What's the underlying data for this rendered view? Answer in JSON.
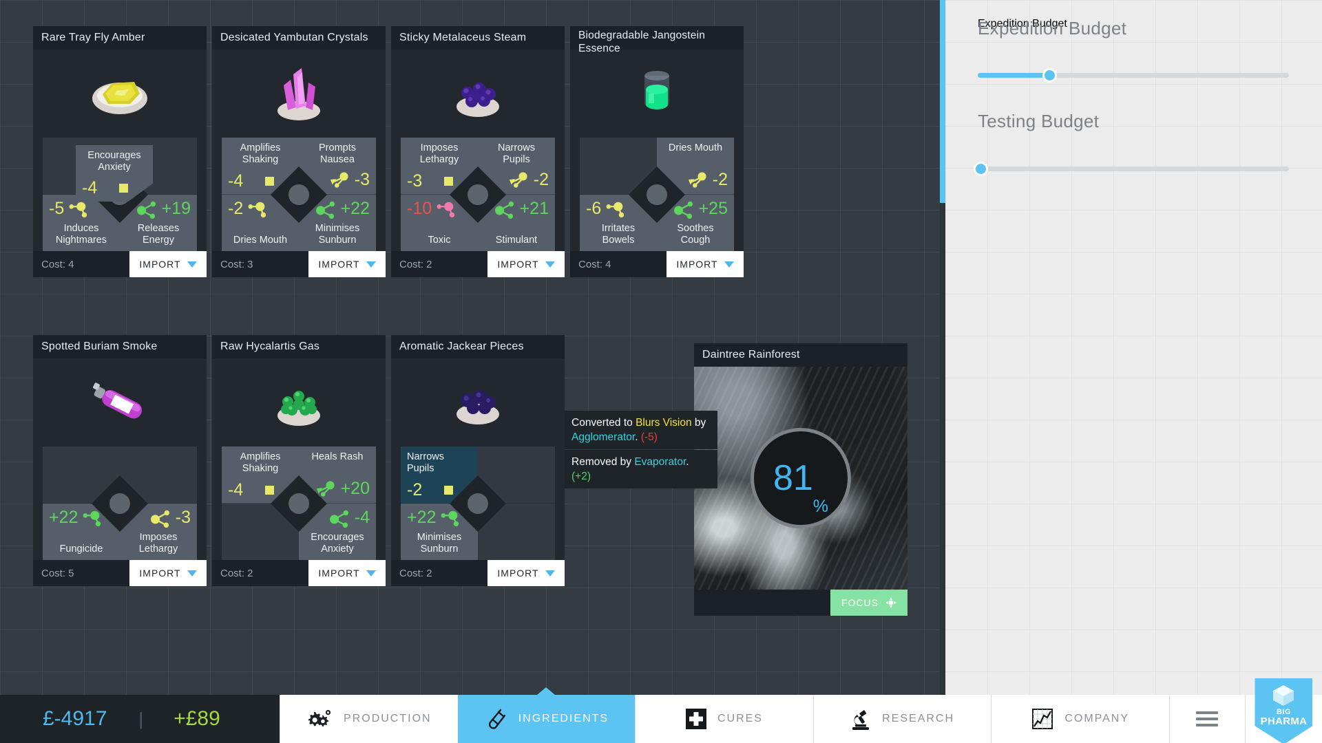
{
  "money": {
    "cash": "£-4917",
    "separator": "|",
    "income": "+£89"
  },
  "nav": {
    "tabs": [
      {
        "label": "PRODUCTION",
        "icon": "gears-icon",
        "active": false
      },
      {
        "label": "INGREDIENTS",
        "icon": "test-tube-icon",
        "active": true
      },
      {
        "label": "CURES",
        "icon": "medical-cross-icon",
        "active": false
      },
      {
        "label": "RESEARCH",
        "icon": "microscope-icon",
        "active": false
      },
      {
        "label": "COMPANY",
        "icon": "line-chart-icon",
        "active": false
      }
    ],
    "menu_icon": "hamburger-menu-icon",
    "logo": {
      "line1": "BIG",
      "line2": "PHARMA"
    }
  },
  "right_panel": {
    "expedition": {
      "title": "Expedition Budget",
      "value_pct": 23
    },
    "testing": {
      "title": "Testing Budget",
      "value_pct": 1
    }
  },
  "scrollbar": {
    "thumb_pct": 29
  },
  "tooltip": {
    "line1_pre": "Converted to ",
    "line1_effect": "Blurs Vision",
    "line1_mid": " by ",
    "line1_machine": "Agglomerator",
    "line1_dot": ".",
    "line1_delta": "(-5)",
    "line2_pre": "Removed by ",
    "line2_machine": "Evaporator",
    "line2_dot": ".",
    "line2_delta": "(+2)"
  },
  "cards": [
    {
      "title": "Rare Tray Fly Amber",
      "image": "amber-nugget-icon",
      "cost": "Cost: 4",
      "action": "IMPORT",
      "action_type": "import",
      "quads": {
        "tl": {
          "label": "Encourages Anxiety",
          "value": "-4",
          "icon": "square-marker-icon",
          "color": "yellow",
          "empty": false
        },
        "tr": {
          "empty": true
        },
        "bl": {
          "label": "Induces Nightmares",
          "value": "-5",
          "icon": "molecule-icon",
          "color": "yellow",
          "empty": false
        },
        "br": {
          "label": "Releases Energy",
          "value": "+19",
          "icon": "molecule-icon",
          "color": "green",
          "empty": false
        }
      }
    },
    {
      "title": "Desicated Yambutan Crystals",
      "image": "crystal-cluster-icon",
      "cost": "Cost: 3",
      "action": "IMPORT",
      "action_type": "import",
      "quads": {
        "tl": {
          "label": "Amplifies Shaking",
          "value": "-4",
          "icon": "square-marker-icon",
          "color": "yellow",
          "empty": false
        },
        "tr": {
          "label": "Prompts Nausea",
          "value": "-3",
          "icon": "arrow-node-icon",
          "color": "yellow",
          "empty": false
        },
        "bl": {
          "label": "Dries Mouth",
          "value": "-2",
          "icon": "molecule-icon",
          "color": "yellow",
          "empty": false
        },
        "br": {
          "label": "Minimises Sunburn",
          "value": "+22",
          "icon": "molecule-icon",
          "color": "green",
          "empty": false
        }
      }
    },
    {
      "title": "Sticky Metalaceus Steam",
      "image": "berry-bowl-icon",
      "cost": "Cost: 2",
      "action": "IMPORT",
      "action_type": "import",
      "quads": {
        "tl": {
          "label": "Imposes Lethargy",
          "value": "-3",
          "icon": "square-marker-icon",
          "color": "yellow",
          "empty": false
        },
        "tr": {
          "label": "Narrows Pupils",
          "value": "-2",
          "icon": "arrow-node-icon",
          "color": "yellow",
          "empty": false
        },
        "bl": {
          "label": "Toxic",
          "value": "-10",
          "icon": "molecule-icon",
          "color": "red",
          "empty": false
        },
        "br": {
          "label": "Stimulant",
          "value": "+21",
          "icon": "molecule-icon",
          "color": "green",
          "empty": false
        }
      }
    },
    {
      "title": "Biodegradable Jangostein Essence",
      "image": "green-liquid-icon",
      "cost": "Cost: 4",
      "action": "IMPORT",
      "action_type": "import",
      "quads": {
        "tl": {
          "empty": true
        },
        "tr": {
          "label": "Dries Mouth",
          "value": "-2",
          "icon": "arrow-node-icon",
          "color": "yellow",
          "empty": false
        },
        "bl": {
          "label": "Irritates Bowels",
          "value": "-6",
          "icon": "molecule-icon",
          "color": "yellow",
          "empty": false
        },
        "br": {
          "label": "Soothes Cough",
          "value": "+25",
          "icon": "molecule-icon",
          "color": "green",
          "empty": false
        }
      }
    },
    {
      "title": "Spotted Buriam Smoke",
      "image": "gas-canister-icon",
      "cost": "Cost: 5",
      "action": "IMPORT",
      "action_type": "import",
      "quads": {
        "tl": {
          "empty": true
        },
        "tr": {
          "empty": true
        },
        "bl": {
          "label": "Fungicide",
          "value": "+22",
          "icon": "molecule-icon",
          "color": "green",
          "empty": false
        },
        "br": {
          "label": "Imposes Lethargy",
          "value": "-3",
          "icon": "molecule-icon",
          "color": "yellow",
          "empty": false
        }
      }
    },
    {
      "title": "Raw Hycalartis Gas",
      "image": "green-pellets-icon",
      "cost": "Cost: 2",
      "action": "IMPORT",
      "action_type": "import",
      "quads": {
        "tl": {
          "label": "Amplifies Shaking",
          "value": "-4",
          "icon": "square-marker-icon",
          "color": "yellow",
          "empty": false
        },
        "tr": {
          "label": "Heals Rash",
          "value": "+20",
          "icon": "arrow-node-icon",
          "color": "green",
          "empty": false
        },
        "bl": {
          "empty": true
        },
        "br": {
          "label": "Encourages Anxiety",
          "value": "-4",
          "icon": "molecule-icon",
          "color": "green",
          "empty": false
        }
      }
    },
    {
      "title": "Aromatic Jackear Pieces",
      "image": "dark-berries-icon",
      "cost": "Cost: 2",
      "action": "IMPORT",
      "action_type": "import",
      "quads": {
        "tl": {
          "label": "Narrows Pupils",
          "value": "-2",
          "icon": "square-marker-icon",
          "color": "yellow",
          "empty": false,
          "highlight": true
        },
        "tr": {
          "empty": true
        },
        "bl": {
          "label": "Minimises Sunburn",
          "value": "+22",
          "icon": "molecule-icon",
          "color": "green",
          "empty": false
        },
        "br": {
          "empty": true
        }
      }
    },
    {
      "title": "Daintree Rainforest",
      "type": "location",
      "percent": "81",
      "percent_symbol": "%",
      "action": "FOCUS",
      "action_type": "focus"
    }
  ]
}
